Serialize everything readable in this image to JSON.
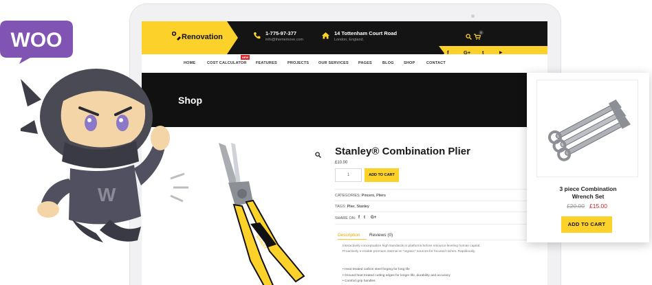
{
  "brand": {
    "woo_logo_text": "WOO",
    "colors": {
      "woo_purple": "#7f54b3",
      "accent": "#fcd12a",
      "dark": "#141414",
      "sale": "#d2232a"
    }
  },
  "mascot": {
    "shirt_letter": "W"
  },
  "header": {
    "logo": "Renovation",
    "phone": "1-775-97-377",
    "email": "info@thememove.com",
    "address": "14 Tottenham Court Road",
    "city": "London, England.",
    "cart_count": "0",
    "social": [
      "f",
      "G+",
      "t",
      "▶"
    ]
  },
  "nav": {
    "items": [
      "HOME",
      "COST CALCULATOR",
      "FEATURES",
      "PROJECTS",
      "OUR SERVICES",
      "PAGES",
      "BLOG",
      "SHOP",
      "CONTACT"
    ],
    "badge": "NEW"
  },
  "banner": {
    "title": "Shop"
  },
  "product": {
    "title": "Stanley® Combination Plier",
    "price": "£10.00",
    "quantity": "1",
    "add_to_cart": "ADD TO CART",
    "categories_label": "CATEGORIES:",
    "categories": "Pincers, Pliers",
    "tags_label": "TAGS:",
    "tags": "Plier, Stanley",
    "share_label": "SHARE ON:",
    "share_icons": [
      "f",
      "t",
      "G+"
    ],
    "tabs": [
      "Description",
      "Reviews (0)"
    ],
    "description": "Interactively conceptualize high standards in platforms before resource-leveling human capital. Proactively e-enable premium internal or \"organic\" sources for focused niches. Rapidiously.",
    "features": [
      "Heat treated carbon steel forging for long life",
      "Ground heat treated cutting edges for longer life, durability and accuracy",
      "Comfort grip handles"
    ]
  },
  "card": {
    "title_line1": "3 piece Combination",
    "title_line2": "Wrench Set",
    "old_price": "£20.00",
    "new_price": "£15.00",
    "button": "ADD TO CART"
  }
}
